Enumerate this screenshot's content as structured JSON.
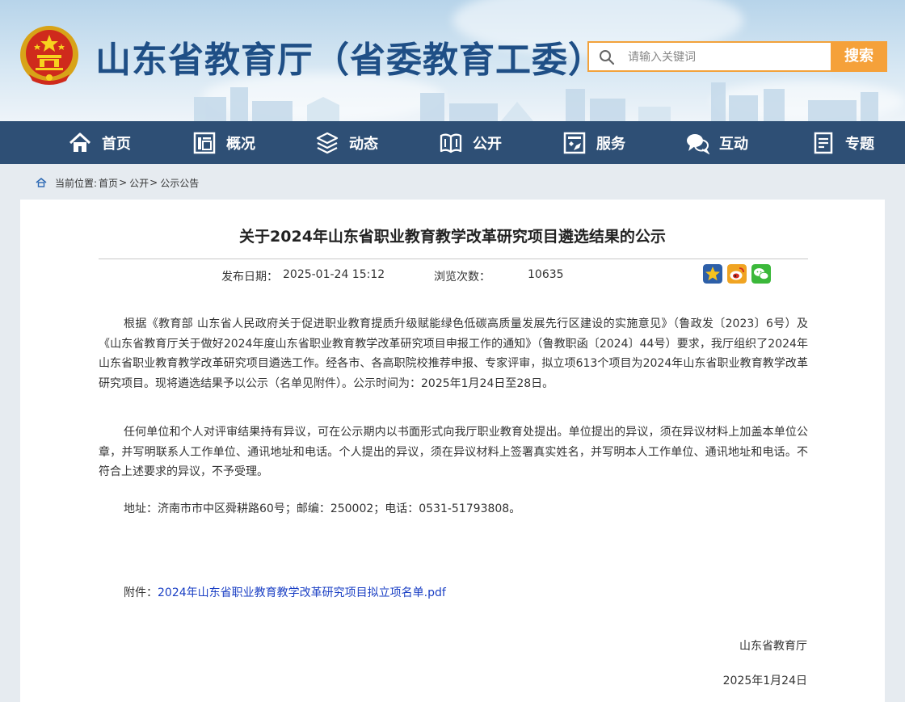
{
  "header": {
    "site_title": "山东省教育厅（省委教育工委）",
    "search_placeholder": "请输入关键词",
    "search_button": "搜索"
  },
  "nav": {
    "items": [
      {
        "label": "首页",
        "icon": "home-icon"
      },
      {
        "label": "概况",
        "icon": "overview-icon"
      },
      {
        "label": "动态",
        "icon": "layers-icon"
      },
      {
        "label": "公开",
        "icon": "book-icon"
      },
      {
        "label": "服务",
        "icon": "service-icon"
      },
      {
        "label": "互动",
        "icon": "chat-icon"
      },
      {
        "label": "专题",
        "icon": "topic-icon"
      }
    ]
  },
  "breadcrumb": {
    "prefix": "当前位置:",
    "items": [
      "首页",
      "公开",
      "公示公告"
    ],
    "separator": ">"
  },
  "article": {
    "title": "关于2024年山东省职业教育教学改革研究项目遴选结果的公示",
    "publish_label": "发布日期：",
    "publish_date": "2025-01-24 15:12",
    "views_label": "浏览次数：",
    "views": "10635",
    "share_icons": [
      "favorite-icon",
      "weibo-icon",
      "wechat-icon"
    ],
    "paragraphs": [
      "根据《教育部 山东省人民政府关于促进职业教育提质升级赋能绿色低碳高质量发展先行区建设的实施意见》（鲁政发〔2023〕6号）及《山东省教育厅关于做好2024年度山东省职业教育教学改革研究项目申报工作的通知》（鲁教职函〔2024〕44号）要求，我厅组织了2024年山东省职业教育教学改革研究项目遴选工作。经各市、各高职院校推荐申报、专家评审，拟立项613个项目为2024年山东省职业教育教学改革研究项目。现将遴选结果予以公示（名单见附件）。公示时间为：2025年1月24日至28日。",
      "任何单位和个人对评审结果持有异议，可在公示期内以书面形式向我厅职业教育处提出。单位提出的异议，须在异议材料上加盖本单位公章，并写明联系人工作单位、通讯地址和电话。个人提出的异议，须在异议材料上签署真实姓名，并写明本人工作单位、通讯地址和电话。不符合上述要求的异议，不予受理。",
      "地址：济南市市中区舜耕路60号；邮编：250002；电话：0531-51793808。"
    ],
    "attachment_label": "附件：",
    "attachment_link": "2024年山东省职业教育教学改革研究项目拟立项名单.pdf",
    "signature": "山东省教育厅",
    "sign_date": "2025年1月24日"
  },
  "colors": {
    "nav_bg": "#2e4f75",
    "title_blue": "#1f4f86",
    "search_orange": "#f5a13a",
    "link_blue": "#1a3fc4"
  }
}
